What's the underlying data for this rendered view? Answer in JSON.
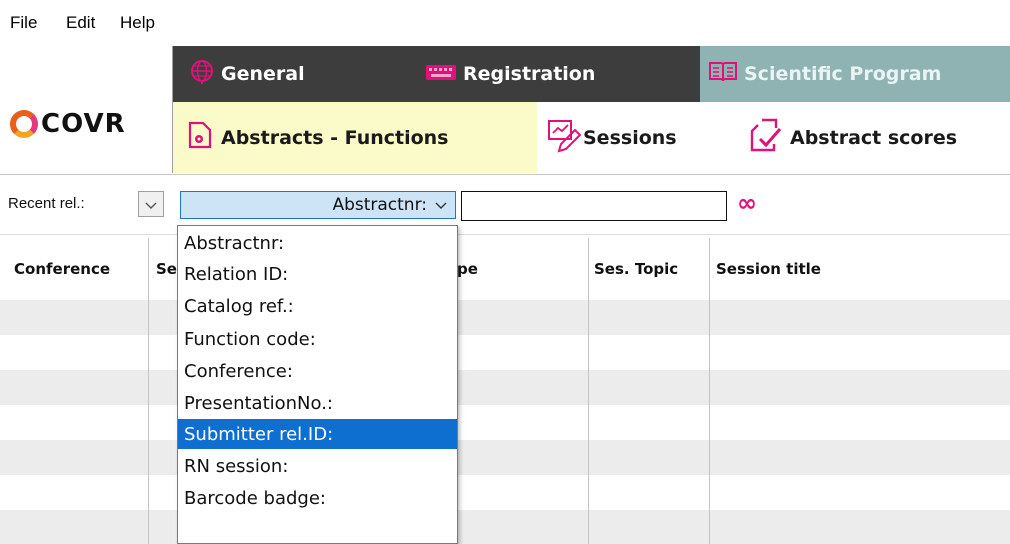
{
  "menu": [
    "File",
    "Edit",
    "Help"
  ],
  "logo": {
    "text": "COVR"
  },
  "top_tabs": [
    {
      "label": "General",
      "icon": "globe-icon",
      "active": false
    },
    {
      "label": "Registration",
      "icon": "keyboard-icon",
      "active": false
    },
    {
      "label": "Scientific Program",
      "icon": "book-icon",
      "active": true
    }
  ],
  "sub_tabs": [
    {
      "label": "Abstracts - Functions",
      "icon": "document-gear-icon",
      "active": true
    },
    {
      "label": "Sessions",
      "icon": "pen-edit-icon",
      "active": false
    },
    {
      "label": "Abstract scores",
      "icon": "document-check-icon",
      "active": false
    }
  ],
  "filter": {
    "recent_label": "Recent rel.:",
    "field_selected": "Abstractnr:",
    "search_value": "",
    "infinity_symbol": "∞"
  },
  "table": {
    "columns": [
      "Conference",
      "Se",
      "pe",
      "Ses. Topic",
      "Session title"
    ]
  },
  "dropdown": {
    "options": [
      "Abstractnr:",
      "Relation ID:",
      "Catalog ref.:",
      "Function code:",
      "Conference:",
      "PresentationNo.:",
      "Submitter rel.ID:",
      "RN session:",
      "Barcode badge:"
    ],
    "highlighted": "Submitter rel.ID:"
  },
  "colors": {
    "accent_pink": "#e0117a",
    "top_tabs_bg": "#3d3d3d",
    "active_top_tab": "#8fb2b2",
    "active_sub_tab": "#fbfbc9",
    "selection_blue": "#0f6fd0"
  }
}
